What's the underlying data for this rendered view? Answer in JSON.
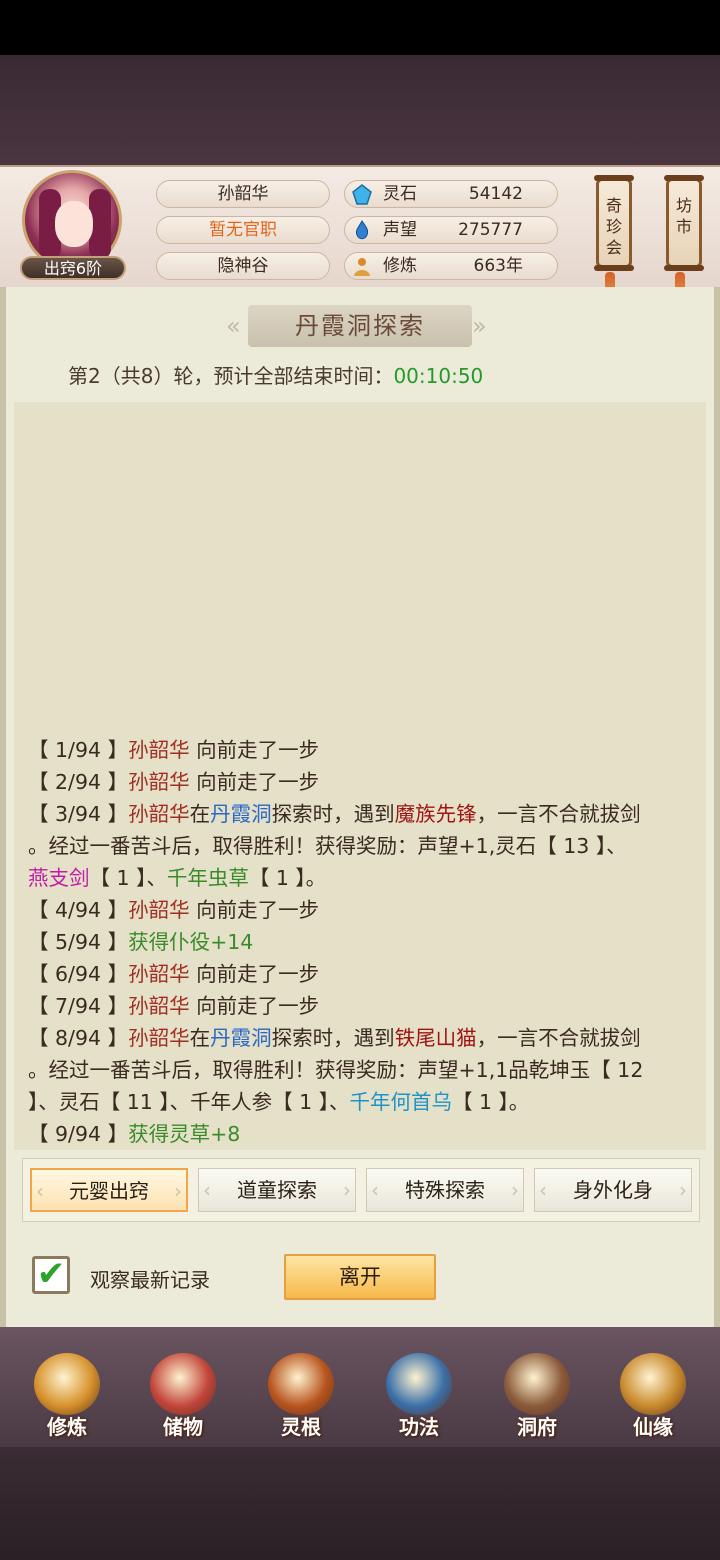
{
  "header": {
    "player_name": "孙韶华",
    "official_post": "暂无官职",
    "sect": "隐神谷",
    "rank_badge": "出窍6阶",
    "resources": [
      {
        "label": "灵石",
        "value": "54142",
        "icon": "spirit-stone-icon"
      },
      {
        "label": "声望",
        "value": "275777",
        "icon": "prestige-flame-icon"
      },
      {
        "label": "修炼",
        "value": "663年",
        "icon": "cultivation-icon"
      }
    ],
    "side_buttons": [
      "奇珍会",
      "坊市"
    ]
  },
  "panel": {
    "title": "丹霞洞探索",
    "round_text": "第2（共8）轮，预计全部结束时间：",
    "round_timer": "00:10:50"
  },
  "log": [
    {
      "segments": [
        {
          "t": "【 1/94 】"
        },
        {
          "t": "孙韶华",
          "c": "name"
        },
        {
          "t": " 向前走了一步"
        }
      ]
    },
    {
      "segments": [
        {
          "t": "【 2/94 】"
        },
        {
          "t": "孙韶华",
          "c": "name"
        },
        {
          "t": " 向前走了一步"
        }
      ]
    },
    {
      "segments": [
        {
          "t": "【 3/94 】"
        },
        {
          "t": "孙韶华",
          "c": "name"
        },
        {
          "t": "在"
        },
        {
          "t": "丹霞洞",
          "c": "place"
        },
        {
          "t": "探索时，遇到"
        },
        {
          "t": "魔族先锋",
          "c": "enemy"
        },
        {
          "t": "，一言不合就拔剑"
        }
      ]
    },
    {
      "segments": [
        {
          "t": "。经过一番苦斗后，取得胜利！获得奖励：声望+1,灵石【 13 】、"
        }
      ]
    },
    {
      "segments": [
        {
          "t": "燕支剑",
          "c": "magenta"
        },
        {
          "t": "【 1 】、"
        },
        {
          "t": "千年虫草",
          "c": "green"
        },
        {
          "t": "【 1 】。"
        }
      ]
    },
    {
      "segments": [
        {
          "t": "【 4/94 】"
        },
        {
          "t": "孙韶华",
          "c": "name"
        },
        {
          "t": " 向前走了一步"
        }
      ]
    },
    {
      "segments": [
        {
          "t": "【 5/94 】"
        },
        {
          "t": "获得仆役+14",
          "c": "green"
        }
      ]
    },
    {
      "segments": [
        {
          "t": "【 6/94 】"
        },
        {
          "t": "孙韶华",
          "c": "name"
        },
        {
          "t": " 向前走了一步"
        }
      ]
    },
    {
      "segments": [
        {
          "t": "【 7/94 】"
        },
        {
          "t": "孙韶华",
          "c": "name"
        },
        {
          "t": " 向前走了一步"
        }
      ]
    },
    {
      "segments": [
        {
          "t": "【 8/94 】"
        },
        {
          "t": "孙韶华",
          "c": "name"
        },
        {
          "t": "在"
        },
        {
          "t": "丹霞洞",
          "c": "place"
        },
        {
          "t": "探索时，遇到"
        },
        {
          "t": "铁尾山猫",
          "c": "enemy"
        },
        {
          "t": "，一言不合就拔剑"
        }
      ]
    },
    {
      "segments": [
        {
          "t": "。经过一番苦斗后，取得胜利！获得奖励：声望+1,1品乾坤玉【 12"
        }
      ]
    },
    {
      "segments": [
        {
          "t": "】、灵石【 11 】、千年人参【 1 】、"
        },
        {
          "t": "千年何首乌",
          "c": "cyan"
        },
        {
          "t": "【 1 】。"
        }
      ]
    },
    {
      "segments": [
        {
          "t": "【 9/94 】"
        },
        {
          "t": "获得灵草+8",
          "c": "green"
        }
      ]
    }
  ],
  "tabs": [
    {
      "label": "元婴出窍",
      "active": true
    },
    {
      "label": "道童探索",
      "active": false
    },
    {
      "label": "特殊探索",
      "active": false
    },
    {
      "label": "身外化身",
      "active": false
    }
  ],
  "controls": {
    "checkbox_label": "观察最新记录",
    "checkbox_checked": true,
    "leave_label": "离开"
  },
  "bottom_nav": [
    {
      "label": "修炼",
      "icon": "meditating-monk-icon",
      "color": "#d6912b"
    },
    {
      "label": "储物",
      "icon": "treasure-bag-icon",
      "color": "#c2453a"
    },
    {
      "label": "灵根",
      "icon": "spirit-root-swirl-icon",
      "color": "#b8541e"
    },
    {
      "label": "功法",
      "icon": "scripture-book-icon",
      "color": "#3a6fa8"
    },
    {
      "label": "洞府",
      "icon": "cave-palace-icon",
      "color": "#8a5a3a"
    },
    {
      "label": "仙缘",
      "icon": "gourd-yinyang-icon",
      "color": "#c8892c"
    }
  ]
}
